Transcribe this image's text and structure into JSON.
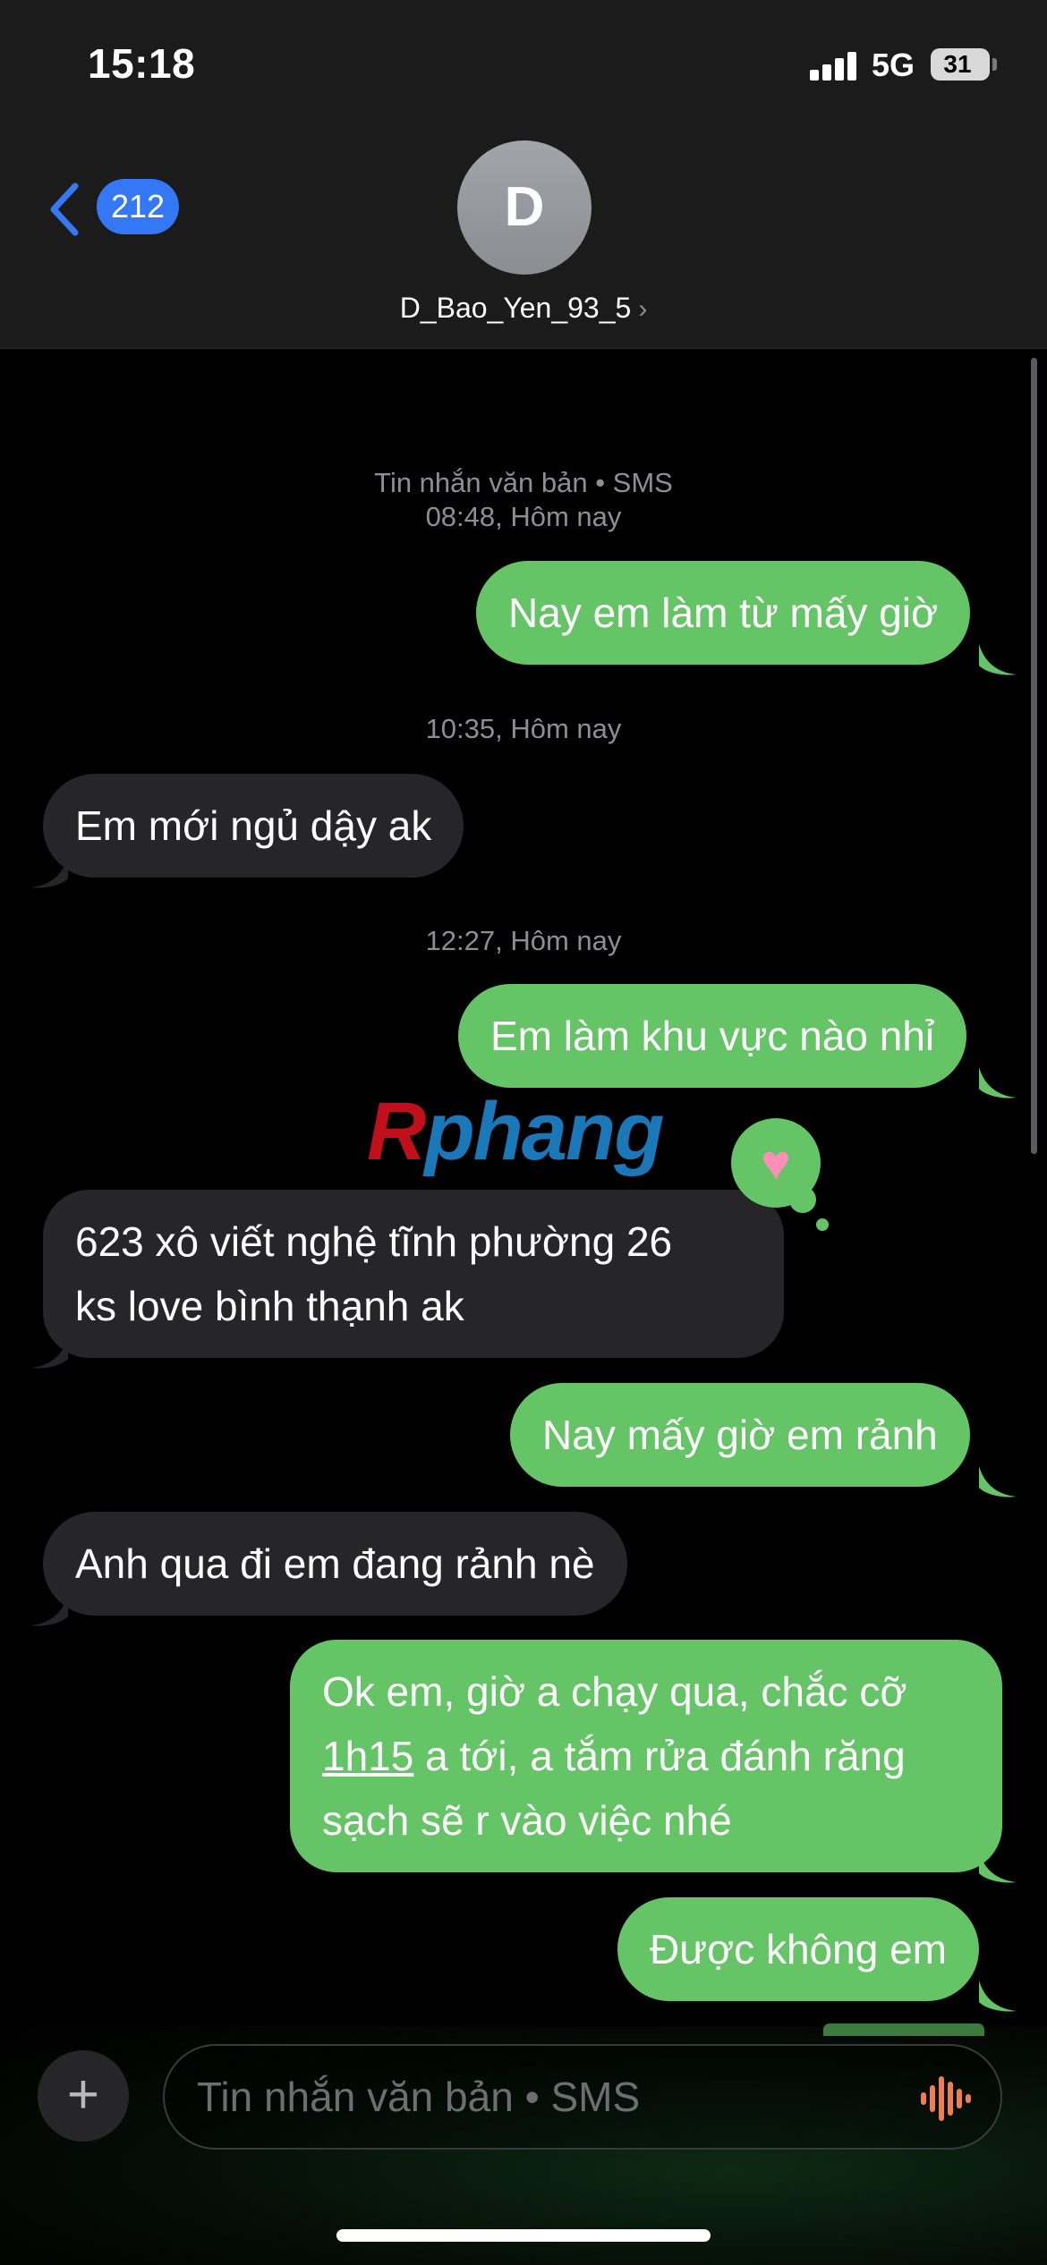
{
  "status_bar": {
    "time": "15:18",
    "network": "5G",
    "battery": "31"
  },
  "header": {
    "back_count": "212",
    "avatar_initial": "D",
    "contact_name": "D_Bao_Yen_93_5",
    "contact_chevron": "›"
  },
  "conversation": {
    "service_label": "Tin nhắn văn bản • SMS",
    "timestamps": [
      "08:48, Hôm nay",
      "10:35, Hôm nay",
      "12:27, Hôm nay"
    ],
    "messages": [
      {
        "direction": "outgoing",
        "text": "Nay em làm từ mấy giờ"
      },
      {
        "direction": "incoming",
        "text": "Em mới ngủ dậy ak"
      },
      {
        "direction": "outgoing",
        "text": "Em làm khu vực nào nhỉ"
      },
      {
        "direction": "incoming",
        "lines": [
          "623 xô viết nghệ tĩnh phường 26",
          "ks love bình thạnh ak"
        ],
        "tapback": "♥"
      },
      {
        "direction": "outgoing",
        "text": "Nay mấy giờ em rảnh"
      },
      {
        "direction": "incoming",
        "text": "Anh qua đi em đang rảnh nè"
      },
      {
        "direction": "outgoing",
        "line1": "Ok em, giờ a chạy qua, chắc cỡ",
        "line2_link": "1h15",
        "line2_rest": " a tới, a tắm rửa đánh răng",
        "line3": "sạch sẽ r vào việc nhé"
      },
      {
        "direction": "outgoing",
        "text": "Được không em"
      }
    ]
  },
  "watermark": {
    "part1": "R",
    "part2": "phang"
  },
  "composer": {
    "plus_icon": "+",
    "placeholder": "Tin nhắn văn bản • SMS",
    "mic_icon": "waveform-icon"
  },
  "colors": {
    "outgoing": "#65c466",
    "incoming": "#262628",
    "accent": "#3478f6"
  }
}
